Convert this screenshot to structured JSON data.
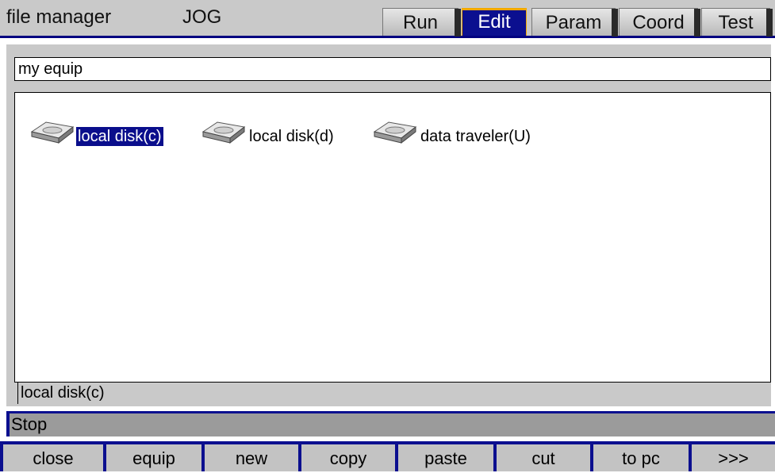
{
  "titlebar": {
    "title": "file manager",
    "mode": "JOG",
    "tabs": [
      {
        "label": "Run",
        "active": false
      },
      {
        "label": "Edit",
        "active": true
      },
      {
        "label": "Param",
        "active": false
      },
      {
        "label": "Coord",
        "active": false
      },
      {
        "label": "Test",
        "active": false
      }
    ]
  },
  "path": {
    "value": "my equip"
  },
  "drives": [
    {
      "label": "local disk(c)",
      "selected": true,
      "icon": "disk-drive-icon"
    },
    {
      "label": "local disk(d)",
      "selected": false,
      "icon": "disk-drive-icon"
    },
    {
      "label": "data traveler(U)",
      "selected": false,
      "icon": "disk-drive-icon"
    }
  ],
  "selection_status": "local disk(c)",
  "machine_status": "Stop",
  "softkeys": [
    "close",
    "equip",
    "new",
    "copy",
    "paste",
    "cut",
    "to pc",
    ">>>"
  ],
  "colors": {
    "accent": "#0b0f8f",
    "active_tab_border": "#f2a900",
    "panel": "#c9c9c9"
  }
}
